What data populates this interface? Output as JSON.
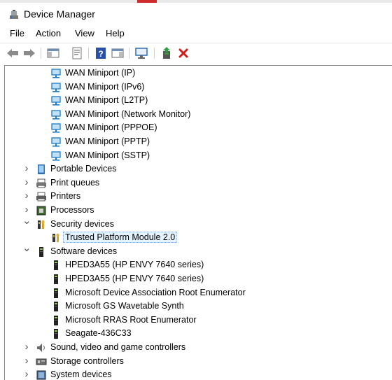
{
  "window": {
    "title": "Device Manager"
  },
  "menu": {
    "file": "File",
    "action": "Action",
    "view": "View",
    "help": "Help"
  },
  "toolbar_icons": [
    "back-arrow-icon",
    "forward-arrow-icon",
    "show-hide-console-tree-icon",
    "properties-icon",
    "help-icon",
    "action-pane-icon",
    "scan-hardware-icon",
    "update-driver-icon",
    "uninstall-device-icon"
  ],
  "tree": {
    "rows": [
      {
        "label": "WAN Miniport (IP)",
        "icon": "network-adapter-icon",
        "level": 2
      },
      {
        "label": "WAN Miniport (IPv6)",
        "icon": "network-adapter-icon",
        "level": 2
      },
      {
        "label": "WAN Miniport (L2TP)",
        "icon": "network-adapter-icon",
        "level": 2
      },
      {
        "label": "WAN Miniport (Network Monitor)",
        "icon": "network-adapter-icon",
        "level": 2
      },
      {
        "label": "WAN Miniport (PPPOE)",
        "icon": "network-adapter-icon",
        "level": 2
      },
      {
        "label": "WAN Miniport (PPTP)",
        "icon": "network-adapter-icon",
        "level": 2
      },
      {
        "label": "WAN Miniport (SSTP)",
        "icon": "network-adapter-icon",
        "level": 2
      },
      {
        "label": "Portable Devices",
        "icon": "portable-device-icon",
        "level": 1,
        "expanded": false
      },
      {
        "label": "Print queues",
        "icon": "print-queue-icon",
        "level": 1,
        "expanded": false
      },
      {
        "label": "Printers",
        "icon": "printer-icon",
        "level": 1,
        "expanded": false
      },
      {
        "label": "Processors",
        "icon": "processor-icon",
        "level": 1,
        "expanded": false
      },
      {
        "label": "Security devices",
        "icon": "security-device-icon",
        "level": 1,
        "expanded": true
      },
      {
        "label": "Trusted Platform Module 2.0",
        "icon": "security-device-icon",
        "level": 2,
        "selected": true
      },
      {
        "label": "Software devices",
        "icon": "software-device-icon",
        "level": 1,
        "expanded": true
      },
      {
        "label": "HPED3A55 (HP ENVY 7640 series)",
        "icon": "software-device-icon",
        "level": 2
      },
      {
        "label": "HPED3A55 (HP ENVY 7640 series)",
        "icon": "software-device-icon",
        "level": 2
      },
      {
        "label": "Microsoft Device Association Root Enumerator",
        "icon": "software-device-icon",
        "level": 2
      },
      {
        "label": "Microsoft GS Wavetable Synth",
        "icon": "software-device-icon",
        "level": 2
      },
      {
        "label": "Microsoft RRAS Root Enumerator",
        "icon": "software-device-icon",
        "level": 2
      },
      {
        "label": "Seagate-436C33",
        "icon": "software-device-icon",
        "level": 2
      },
      {
        "label": "Sound, video and game controllers",
        "icon": "sound-icon",
        "level": 1,
        "expanded": false
      },
      {
        "label": "Storage controllers",
        "icon": "storage-controller-icon",
        "level": 1,
        "expanded": false
      },
      {
        "label": "System devices",
        "icon": "system-device-icon",
        "level": 1,
        "expanded": false
      }
    ]
  }
}
